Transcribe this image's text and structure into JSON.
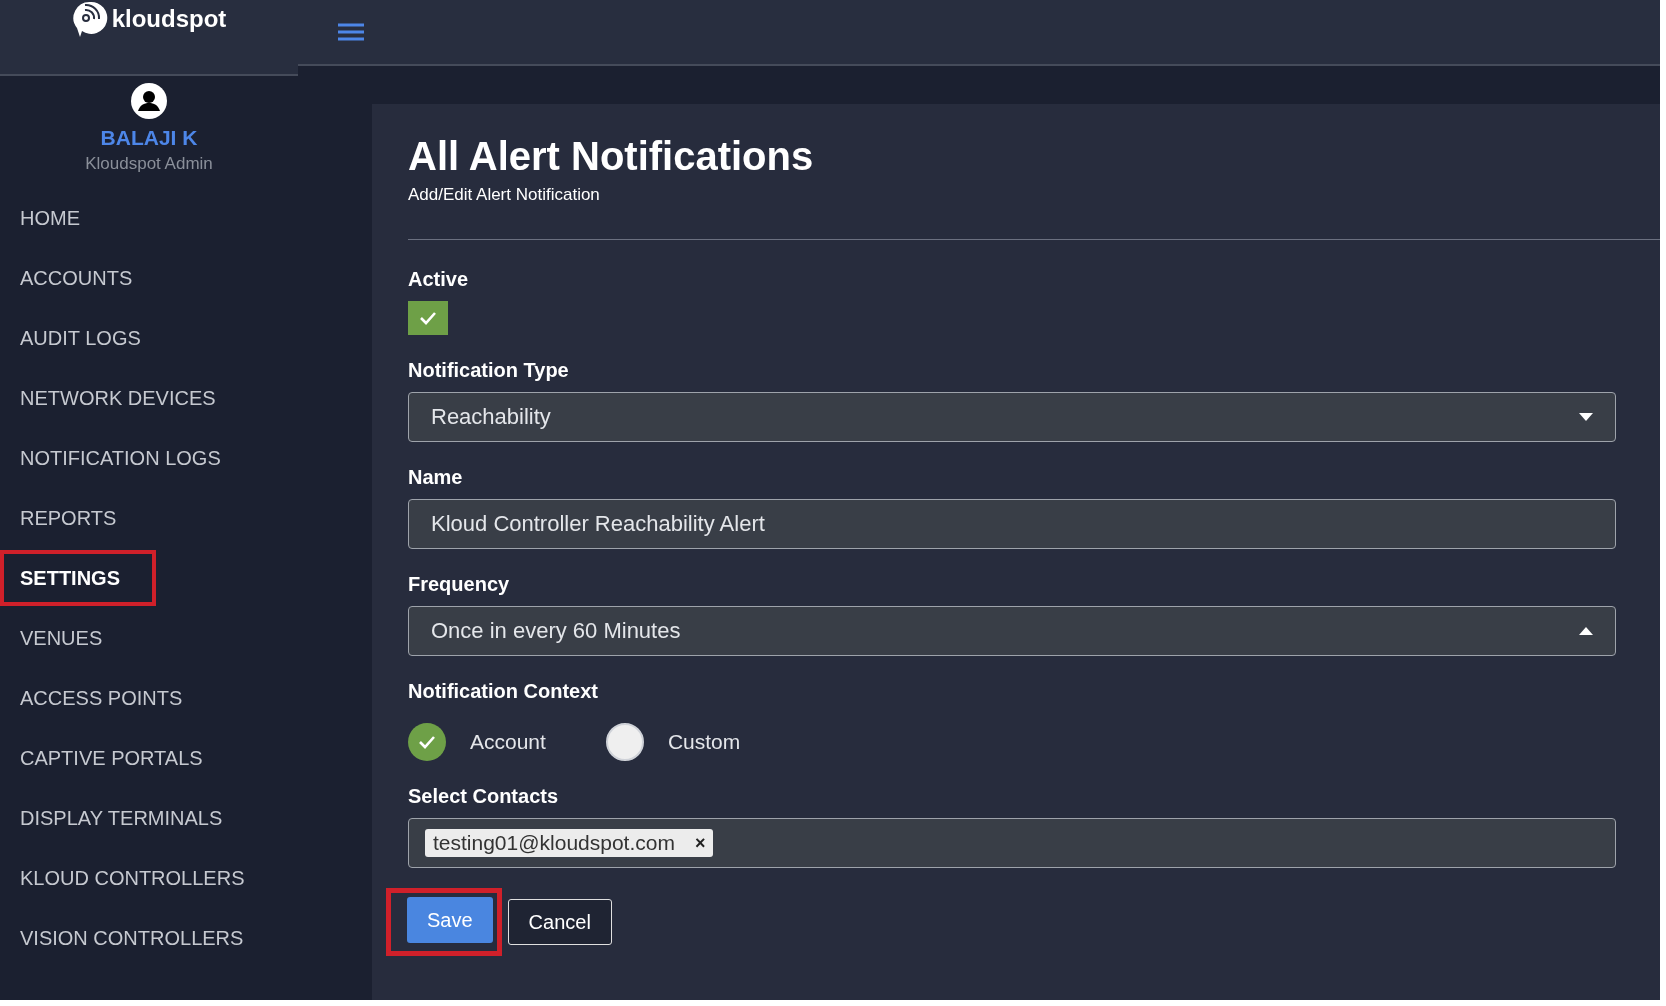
{
  "header": {
    "logo_text": "kloudspot"
  },
  "user": {
    "name": "BALAJI K",
    "role": "Kloudspot Admin"
  },
  "nav": [
    {
      "label": "HOME",
      "selected": false
    },
    {
      "label": "ACCOUNTS",
      "selected": false
    },
    {
      "label": "AUDIT LOGS",
      "selected": false
    },
    {
      "label": "NETWORK DEVICES",
      "selected": false
    },
    {
      "label": "NOTIFICATION LOGS",
      "selected": false
    },
    {
      "label": "REPORTS",
      "selected": false
    },
    {
      "label": "SETTINGS",
      "selected": true
    },
    {
      "label": "VENUES",
      "selected": false
    },
    {
      "label": "ACCESS POINTS",
      "selected": false
    },
    {
      "label": "CAPTIVE PORTALS",
      "selected": false
    },
    {
      "label": "DISPLAY TERMINALS",
      "selected": false
    },
    {
      "label": "KLOUD CONTROLLERS",
      "selected": false
    },
    {
      "label": "VISION CONTROLLERS",
      "selected": false
    }
  ],
  "form": {
    "title": "All Alert Notifications",
    "subtitle": "Add/Edit Alert Notification",
    "fields": [
      {
        "kind": "checkbox",
        "label": "Active",
        "checked": true
      },
      {
        "kind": "select",
        "label": "Notification Type",
        "value": "Reachability",
        "open": false
      },
      {
        "kind": "text",
        "label": "Name",
        "value": "Kloud Controller Reachability Alert"
      },
      {
        "kind": "select",
        "label": "Frequency",
        "value": "Once in every 60 Minutes",
        "open": true
      },
      {
        "kind": "radio",
        "label": "Notification Context",
        "options": [
          {
            "label": "Account",
            "selected": true
          },
          {
            "label": "Custom",
            "selected": false
          }
        ]
      },
      {
        "kind": "tags",
        "label": "Select Contacts",
        "tags": [
          {
            "text": "testing01@kloudspot.com",
            "remove": "×"
          }
        ]
      }
    ],
    "buttons": [
      {
        "label": "Save",
        "kind": "primary",
        "highlighted": true
      },
      {
        "label": "Cancel",
        "kind": "secondary",
        "highlighted": false
      }
    ]
  }
}
